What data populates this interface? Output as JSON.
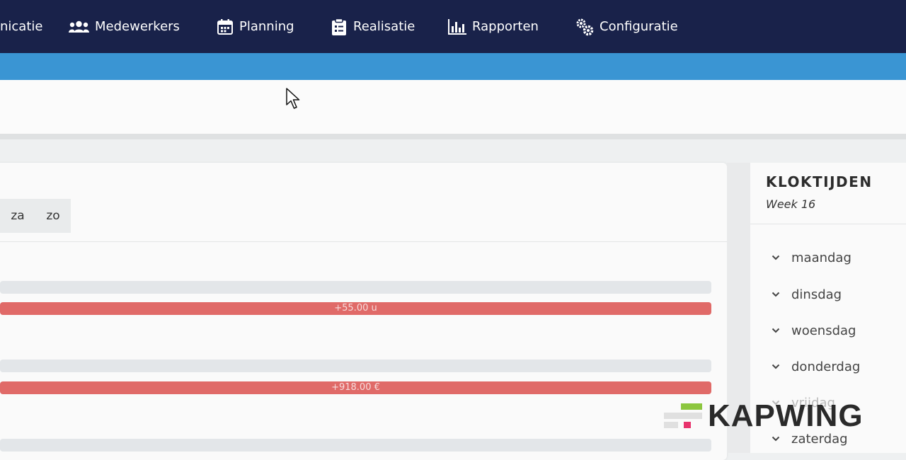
{
  "nav": {
    "items": [
      {
        "label": "nicatie",
        "icon": "communication-icon"
      },
      {
        "label": "Medewerkers",
        "icon": "users-icon"
      },
      {
        "label": "Planning",
        "icon": "calendar-icon"
      },
      {
        "label": "Realisatie",
        "icon": "clipboard-icon"
      },
      {
        "label": "Rapporten",
        "icon": "bar-chart-icon"
      },
      {
        "label": "Configuratie",
        "icon": "gears-icon"
      }
    ]
  },
  "main": {
    "day_tabs": [
      "za",
      "zo"
    ],
    "bar1_label": "+55.00 u",
    "bar2_label": "+918.00 €"
  },
  "side": {
    "title": "KLOKTIJDEN",
    "subtitle": "Week 16",
    "days": [
      "maandag",
      "dinsdag",
      "woensdag",
      "donderdag",
      "vrijdag",
      "zaterdag"
    ]
  },
  "watermark": {
    "text": "KAPWING"
  },
  "colors": {
    "nav_bg": "#19224a",
    "accent_bar": "#3a95d3",
    "bar_red": "#e06a68",
    "bar_grey": "#e3e6e9"
  }
}
